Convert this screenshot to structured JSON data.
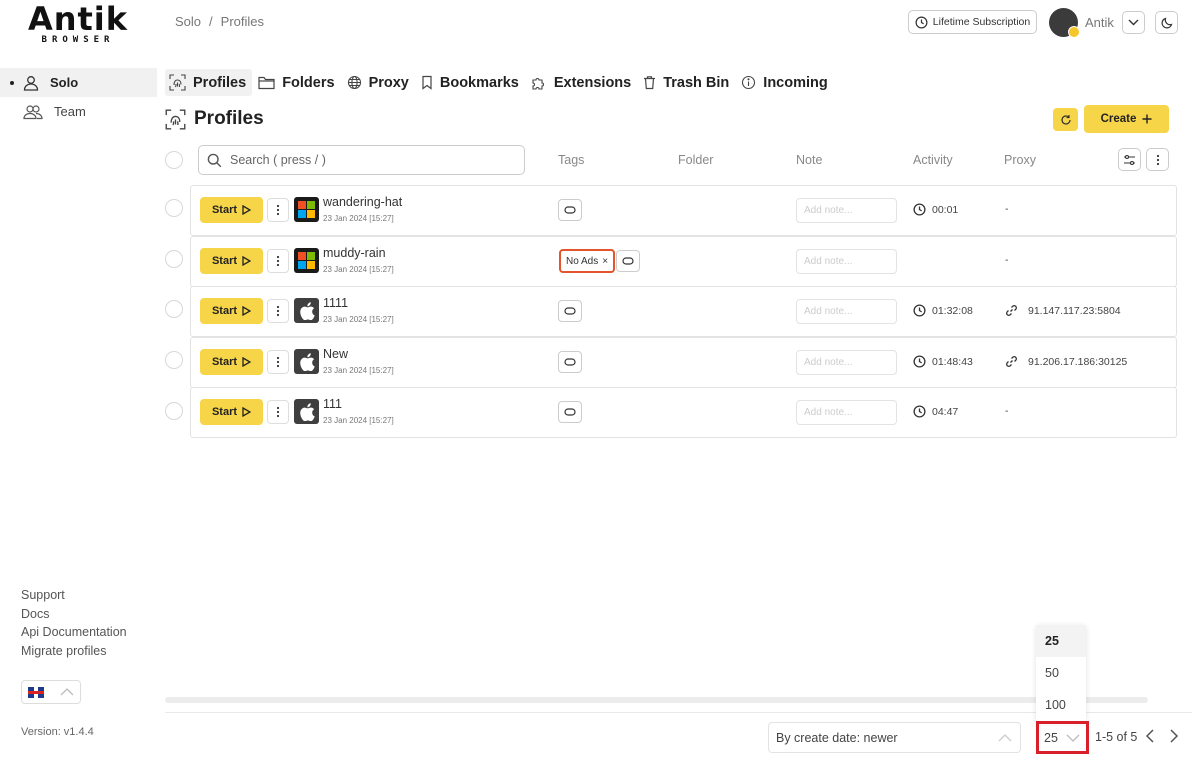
{
  "brand": {
    "logo_main": "Antik",
    "logo_sub": "BROWSER"
  },
  "sidebar": {
    "items": [
      {
        "label": "Solo",
        "active": true
      },
      {
        "label": "Team",
        "active": false
      }
    ],
    "links": [
      "Support",
      "Docs",
      "Api Documentation",
      "Migrate profiles"
    ],
    "version": "Version: v1.4.4"
  },
  "header": {
    "breadcrumb": [
      "Solo",
      "Profiles"
    ],
    "subscription_label": "Lifetime Subscription",
    "user_name": "Antik"
  },
  "tabs": [
    "Profiles",
    "Folders",
    "Proxy",
    "Bookmarks",
    "Extensions",
    "Trash Bin",
    "Incoming"
  ],
  "page": {
    "title": "Profiles",
    "create_label": "Create",
    "search_placeholder": "Search ( press / )",
    "columns": {
      "tags": "Tags",
      "folder": "Folder",
      "note": "Note",
      "activity": "Activity",
      "proxy": "Proxy"
    }
  },
  "profiles": [
    {
      "name": "wandering-hat",
      "date": "23 Jan 2024 [15:27]",
      "os": "windows",
      "tag": "",
      "activity": "00:01",
      "proxy": "-"
    },
    {
      "name": "muddy-rain",
      "date": "23 Jan 2024 [15:27]",
      "os": "windows",
      "tag": "No Ads",
      "activity": "",
      "proxy": "-"
    },
    {
      "name": "1111",
      "date": "23 Jan 2024 [15:27]",
      "os": "mac",
      "tag": "",
      "activity": "01:32:08",
      "proxy": "91.147.117.23:5804"
    },
    {
      "name": "New",
      "date": "23 Jan 2024 [15:27]",
      "os": "mac",
      "tag": "",
      "activity": "01:48:43",
      "proxy": "91.206.17.186:30125"
    },
    {
      "name": "111",
      "date": "23 Jan 2024 [15:27]",
      "os": "mac",
      "tag": "",
      "activity": "04:47",
      "proxy": "-"
    }
  ],
  "row_labels": {
    "start": "Start",
    "note_placeholder": "Add note..."
  },
  "footer": {
    "sort_value": "By create date: newer",
    "per_page_value": "25",
    "per_page_options": [
      "25",
      "50",
      "100"
    ],
    "range": "1-5 of 5"
  },
  "colors": {
    "accent": "#f7d548",
    "highlight": "#d9202a",
    "tag_border": "#e4552b"
  }
}
